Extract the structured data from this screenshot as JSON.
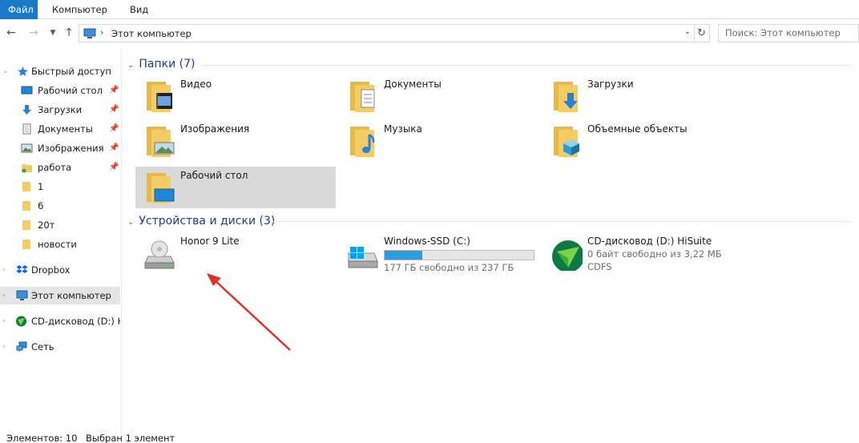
{
  "ribbon": {
    "tabs": [
      "Файл",
      "Компьютер",
      "Вид"
    ]
  },
  "address": {
    "location": "Этот компьютер",
    "search_placeholder": "Поиск: Этот компьютер"
  },
  "nav": {
    "quick_access": "Быстрый доступ",
    "quick_items": [
      "Рабочий стол",
      "Загрузки",
      "Документы",
      "Изображения",
      "работа",
      "1",
      "6",
      "20т",
      "новости"
    ],
    "dropbox": "Dropbox",
    "this_pc": "Этот компьютер",
    "cd": "CD-дисковод (D:) HiSuite",
    "network": "Сеть"
  },
  "groups": {
    "folders_title": "Папки (7)",
    "devices_title": "Устройства и диски (3)"
  },
  "folders": [
    "Видео",
    "Документы",
    "Загрузки",
    "Изображения",
    "Музыка",
    "Объемные объекты",
    "Рабочий стол"
  ],
  "devices": [
    {
      "name": "Honor 9 Lite"
    },
    {
      "name": "Windows-SSD (C:)",
      "usage": "177 ГБ свободно из 237 ГБ",
      "used_fraction": 0.25
    },
    {
      "name": "CD-дисковод (D:) HiSuite",
      "usage": "0 байт свободно из 3,22 МБ",
      "fs": "CDFS"
    }
  ],
  "status": {
    "count": "Элементов: 10",
    "selected": "Выбран 1 элемент"
  },
  "colors": {
    "accent": "#1979ca",
    "group_title": "#1e3d8f",
    "folder": "#f3cd64",
    "arrow": "#d9322b",
    "bar_fill": "#26a0da"
  }
}
